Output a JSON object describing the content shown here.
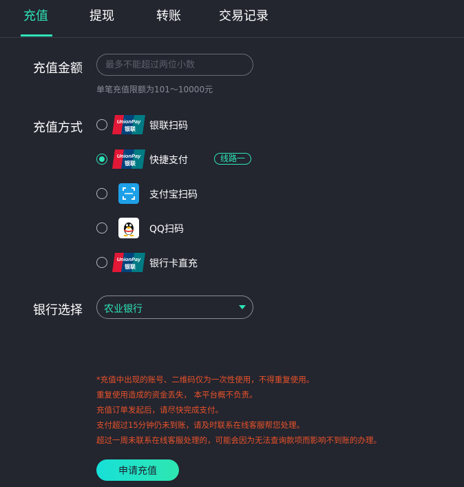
{
  "tabs": [
    {
      "label": "充值",
      "active": true
    },
    {
      "label": "提现",
      "active": false
    },
    {
      "label": "转账",
      "active": false
    },
    {
      "label": "交易记录",
      "active": false
    }
  ],
  "amount": {
    "label": "充值金额",
    "placeholder": "最多不能超过两位小数",
    "value": "",
    "hint": "单笔充值限额为101～10000元"
  },
  "methods": {
    "label": "充值方式",
    "items": [
      {
        "label": "银联扫码",
        "icon": "unionpay-icon",
        "selected": false
      },
      {
        "label": "快捷支付",
        "icon": "unionpay-icon",
        "selected": true,
        "badge": "线路一"
      },
      {
        "label": "支付宝扫码",
        "icon": "alipay-scan-icon",
        "selected": false
      },
      {
        "label": "QQ扫码",
        "icon": "qq-penguin-icon",
        "selected": false
      },
      {
        "label": "银行卡直充",
        "icon": "unionpay-icon",
        "selected": false
      }
    ]
  },
  "bank": {
    "label": "银行选择",
    "selected": "农业银行"
  },
  "notes": [
    "*充值中出现的账号、二维码仅为一次性使用，不得重复使用。",
    "重复使用造成的资金丢失， 本平台概不负责。",
    "充值订单发起后，请尽快完成支付。",
    "支付超过15分钟仍未到账，请及时联系在线客服帮您处理。",
    "超过一周未联系在线客服处理的，可能会因为无法查询款项而影响不到账的办理。"
  ],
  "submit_label": "申请充值",
  "colors": {
    "background": "#23252f",
    "accent": "#2ee6b8",
    "warning": "#e8522a",
    "unionpay_red": "#e21836",
    "unionpay_blue": "#00447c",
    "unionpay_green": "#007b84",
    "alipay_blue": "#1ea0e8"
  }
}
